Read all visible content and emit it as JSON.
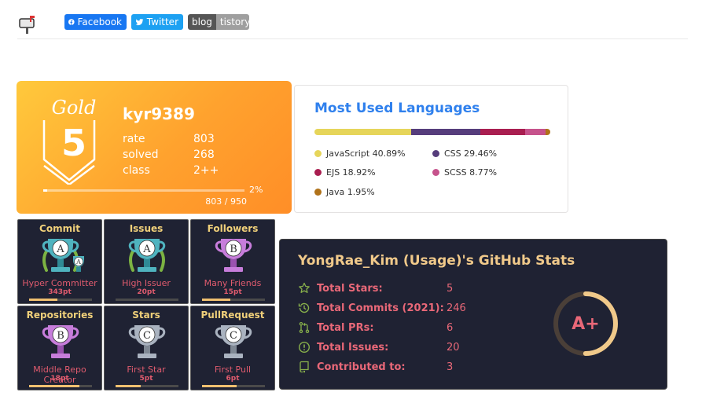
{
  "header": {
    "mailbox_icon": "mailbox-icon",
    "facebook": "Facebook",
    "twitter": "Twitter",
    "blog_left": "blog",
    "blog_right": "tistory"
  },
  "solved": {
    "tier_name": "Gold",
    "tier_level": "5",
    "handle": "kyr9389",
    "rows": [
      {
        "label": "rate",
        "value": "803"
      },
      {
        "label": "solved",
        "value": "268"
      },
      {
        "label": "class",
        "value": "2++"
      }
    ],
    "progress_pct_text": "2%",
    "progress_fraction": 0.02,
    "progress_count": "803 / 950",
    "colors": {
      "start": "#ffc93c",
      "end": "#ff8e27"
    }
  },
  "languages": {
    "title": "Most Used Languages",
    "items": [
      {
        "name": "JavaScript",
        "pct": 40.89,
        "label": "JavaScript 40.89%",
        "color": "#e6d55a"
      },
      {
        "name": "CSS",
        "pct": 29.46,
        "label": "CSS 29.46%",
        "color": "#563d7c"
      },
      {
        "name": "EJS",
        "pct": 18.92,
        "label": "EJS 18.92%",
        "color": "#a91e50"
      },
      {
        "name": "SCSS",
        "pct": 8.77,
        "label": "SCSS 8.77%",
        "color": "#c6538c"
      },
      {
        "name": "Java",
        "pct": 1.95,
        "label": "Java 1.95%",
        "color": "#b07219"
      }
    ]
  },
  "trophies": [
    {
      "title": "Commit",
      "rank": "A",
      "subtitle": "Hyper Committer",
      "points": "343pt",
      "progress": 0.45,
      "cup": "teal",
      "extra": "A"
    },
    {
      "title": "Issues",
      "rank": "A",
      "subtitle": "High Issuer",
      "points": "20pt",
      "progress": 0.0,
      "cup": "teal",
      "extra": ""
    },
    {
      "title": "Followers",
      "rank": "B",
      "subtitle": "Many Friends",
      "points": "15pt",
      "progress": 0.45,
      "cup": "purple",
      "extra": ""
    },
    {
      "title": "Repositories",
      "rank": "B",
      "subtitle": "Middle Repo Creator",
      "points": "18pt",
      "progress": 0.8,
      "cup": "purple",
      "extra": ""
    },
    {
      "title": "Stars",
      "rank": "C",
      "subtitle": "First Star",
      "points": "5pt",
      "progress": 0.4,
      "cup": "silver",
      "extra": ""
    },
    {
      "title": "PullRequest",
      "rank": "C",
      "subtitle": "First Pull",
      "points": "6pt",
      "progress": 0.55,
      "cup": "silver",
      "extra": ""
    }
  ],
  "github": {
    "title": "YongRae_Kim (Usage)'s GitHub Stats",
    "rows": [
      {
        "icon": "star-icon",
        "label": "Total Stars:",
        "value": "5"
      },
      {
        "icon": "history-icon",
        "label": "Total Commits (2021):",
        "value": "246"
      },
      {
        "icon": "pull-request-icon",
        "label": "Total PRs:",
        "value": "6"
      },
      {
        "icon": "issue-icon",
        "label": "Total Issues:",
        "value": "20"
      },
      {
        "icon": "repo-icon",
        "label": "Contributed to:",
        "value": "3"
      }
    ],
    "rank": "A+",
    "rank_progress": 0.5,
    "colors": {
      "title": "#f0c98a",
      "text": "#e96878",
      "icon": "#88b04b",
      "bg": "#1f2233"
    }
  }
}
